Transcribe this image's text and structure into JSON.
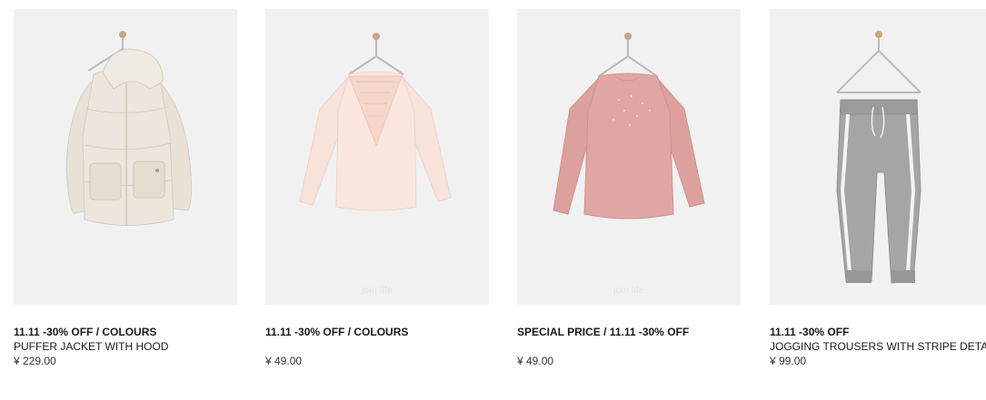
{
  "products": [
    {
      "promo": "11.11 -30% OFF / COLOURS",
      "name": "PUFFER JACKET WITH HOOD",
      "price": "¥ 229.00",
      "watermark": "",
      "image": "cream-puffer-jacket",
      "color": "#ebe5db"
    },
    {
      "promo": "11.11 -30% OFF / COLOURS",
      "name": "",
      "price": "¥ 49.00",
      "watermark": "join life",
      "image": "light-pink-lace-top",
      "color": "#f7dfd5"
    },
    {
      "promo": "SPECIAL PRICE / 11.11 -30% OFF",
      "name": "",
      "price": "¥ 49.00",
      "watermark": "join life",
      "image": "pink-sweatshirt",
      "color": "#dfa4a1"
    },
    {
      "promo": "11.11 -30% OFF",
      "name": "JOGGING TROUSERS WITH STRIPE DETAIL",
      "price": "¥ 99.00",
      "watermark": "",
      "image": "grey-jogging-trousers",
      "color": "#a3a3a3"
    }
  ]
}
